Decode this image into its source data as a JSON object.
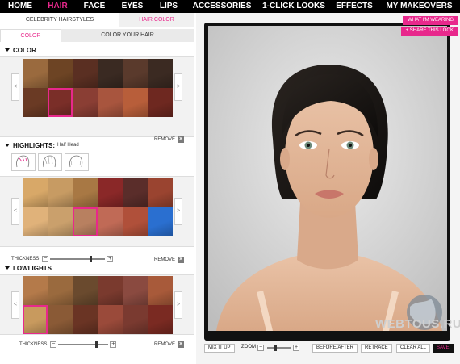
{
  "nav": {
    "items": [
      "HOME",
      "HAIR",
      "FACE",
      "EYES",
      "LIPS",
      "ACCESSORIES",
      "1-CLICK LOOKS",
      "EFFECTS",
      "MY MAKEOVERS"
    ],
    "active_index": 1
  },
  "subtabs": {
    "celebrity": "CELEBRITY HAIRSTYLES",
    "hair_color": "HAIR COLOR",
    "color": "COLOR",
    "color_your_hair": "COLOR YOUR HAIR"
  },
  "color_section": {
    "title": "COLOR",
    "remove_label": "REMOVE",
    "prev_label": "<",
    "next_label": ">",
    "swatches": [
      "#9a6a3e",
      "#6d4424",
      "#5a2f22",
      "#3a2a22",
      "#5a3a2c",
      "#3b2a22",
      "#6a3a24",
      "#7a2e28",
      "#8a3e34",
      "#a8553e",
      "#b85e3a",
      "#6e2820"
    ],
    "selected_index": 7
  },
  "highlights_section": {
    "title": "HIGHLIGHTS:",
    "subtitle": "Half Head",
    "remove_label": "REMOVE",
    "thickness_label": "THICKNESS",
    "thickness_value": 0.72,
    "prev_label": "<",
    "next_label": ">",
    "pattern_selected_index": 0,
    "swatches": [
      "#d8a868",
      "#c79b63",
      "#a87844",
      "#8a2828",
      "#5a2d2a",
      "#9a4430",
      "#e0b27a",
      "#caa06c",
      "#b88060",
      "#c06a56",
      "#b0503a",
      "#2a6fd0"
    ],
    "selected_index": 8
  },
  "lowlights_section": {
    "title": "LOWLIGHTS",
    "thickness_label": "THICKNESS",
    "thickness_value": 0.74,
    "remove_label": "REMOVE",
    "prev_label": "<",
    "next_label": ">",
    "swatches": [
      "#b47a4a",
      "#9a6a3e",
      "#6a4a2e",
      "#7a3a2e",
      "#8a4a40",
      "#a85a3a",
      "#c89a5e",
      "#8a5a36",
      "#6a3424",
      "#9a4a3a",
      "#7a3a30",
      "#7a2a22"
    ],
    "selected_index": 6
  },
  "right": {
    "what_im_wearing": "WHAT I'M WEARING",
    "share_this_look": "+ SHARE THIS LOOK",
    "mix_it_up": "MIX IT UP",
    "zoom_label": "ZOOM",
    "zoom_value": 0.3,
    "before_after": "BEFORE/AFTER",
    "retrace": "RETRACE",
    "clear_all": "CLEAR ALL",
    "save": "SAVE",
    "watermark": "WEBTOUS.RU"
  },
  "colors": {
    "accent": "#e8288c",
    "nav_bg": "#000000"
  }
}
